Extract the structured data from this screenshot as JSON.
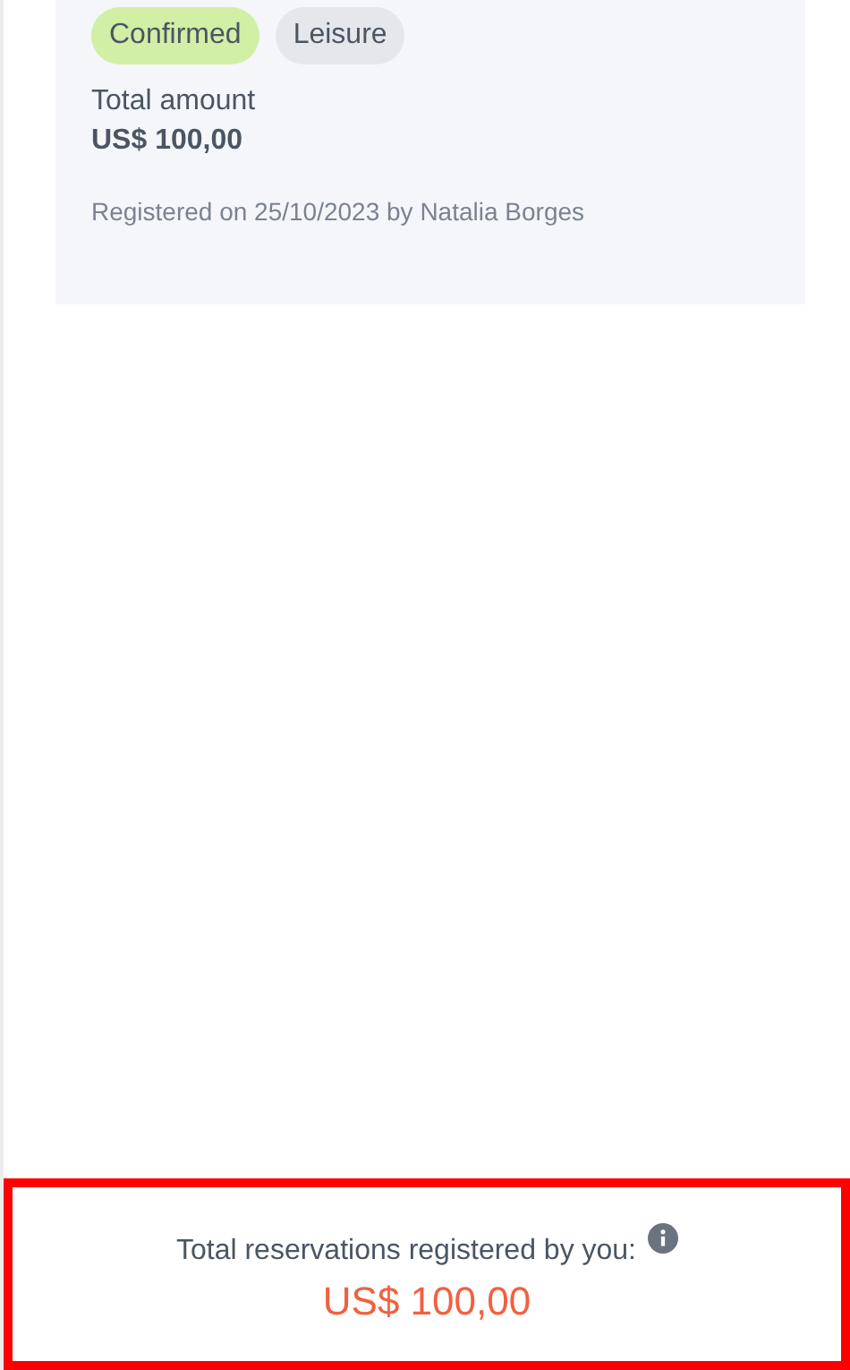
{
  "reservation_card": {
    "tags": [
      {
        "label": "Confirmed",
        "color": "#d1efa5"
      },
      {
        "label": "Leisure",
        "color": "#e5e7eb"
      }
    ],
    "amount_label": "Total amount",
    "amount": "US$ 100,00",
    "registered": "Registered on 25/10/2023 by Natalia Borges"
  },
  "footer": {
    "label": "Total reservations registered by you:",
    "total": "US$ 100,00"
  }
}
